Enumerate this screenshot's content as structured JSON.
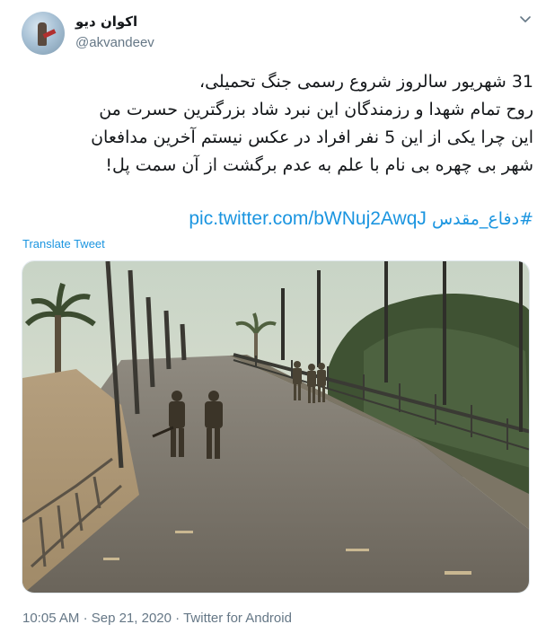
{
  "author": {
    "display_name": "اکوان دیو",
    "handle": "@akvandeev",
    "avatar_icon": "avatar-image"
  },
  "menu": {
    "icon": "chevron-down-icon"
  },
  "tweet": {
    "lines": [
      "31 شهریور سالروز شروع رسمی جنگ تحمیلی،",
      "روح تمام شهدا و رزمندگان این نبرد شاد بزرگترین حسرت من",
      "این چرا یکی از این 5 نفر افراد در عکس نیستم آخرین مدافعان",
      "شهر  بی چهره بی نام با علم به عدم برگشت از آن سمت پل!"
    ],
    "hashtag": "#دفاع_مقدس",
    "link": "pic.twitter.com/bWNuj2AwqJ"
  },
  "translate_label": "Translate Tweet",
  "media": {
    "description_icon": "photo-bridge-soldiers"
  },
  "meta": {
    "time": "10:05 AM",
    "separator": "·",
    "date": "Sep 21, 2020",
    "source": "Twitter for Android"
  },
  "colors": {
    "link": "#1b95e0",
    "secondary": "#657786",
    "text": "#14171a"
  }
}
